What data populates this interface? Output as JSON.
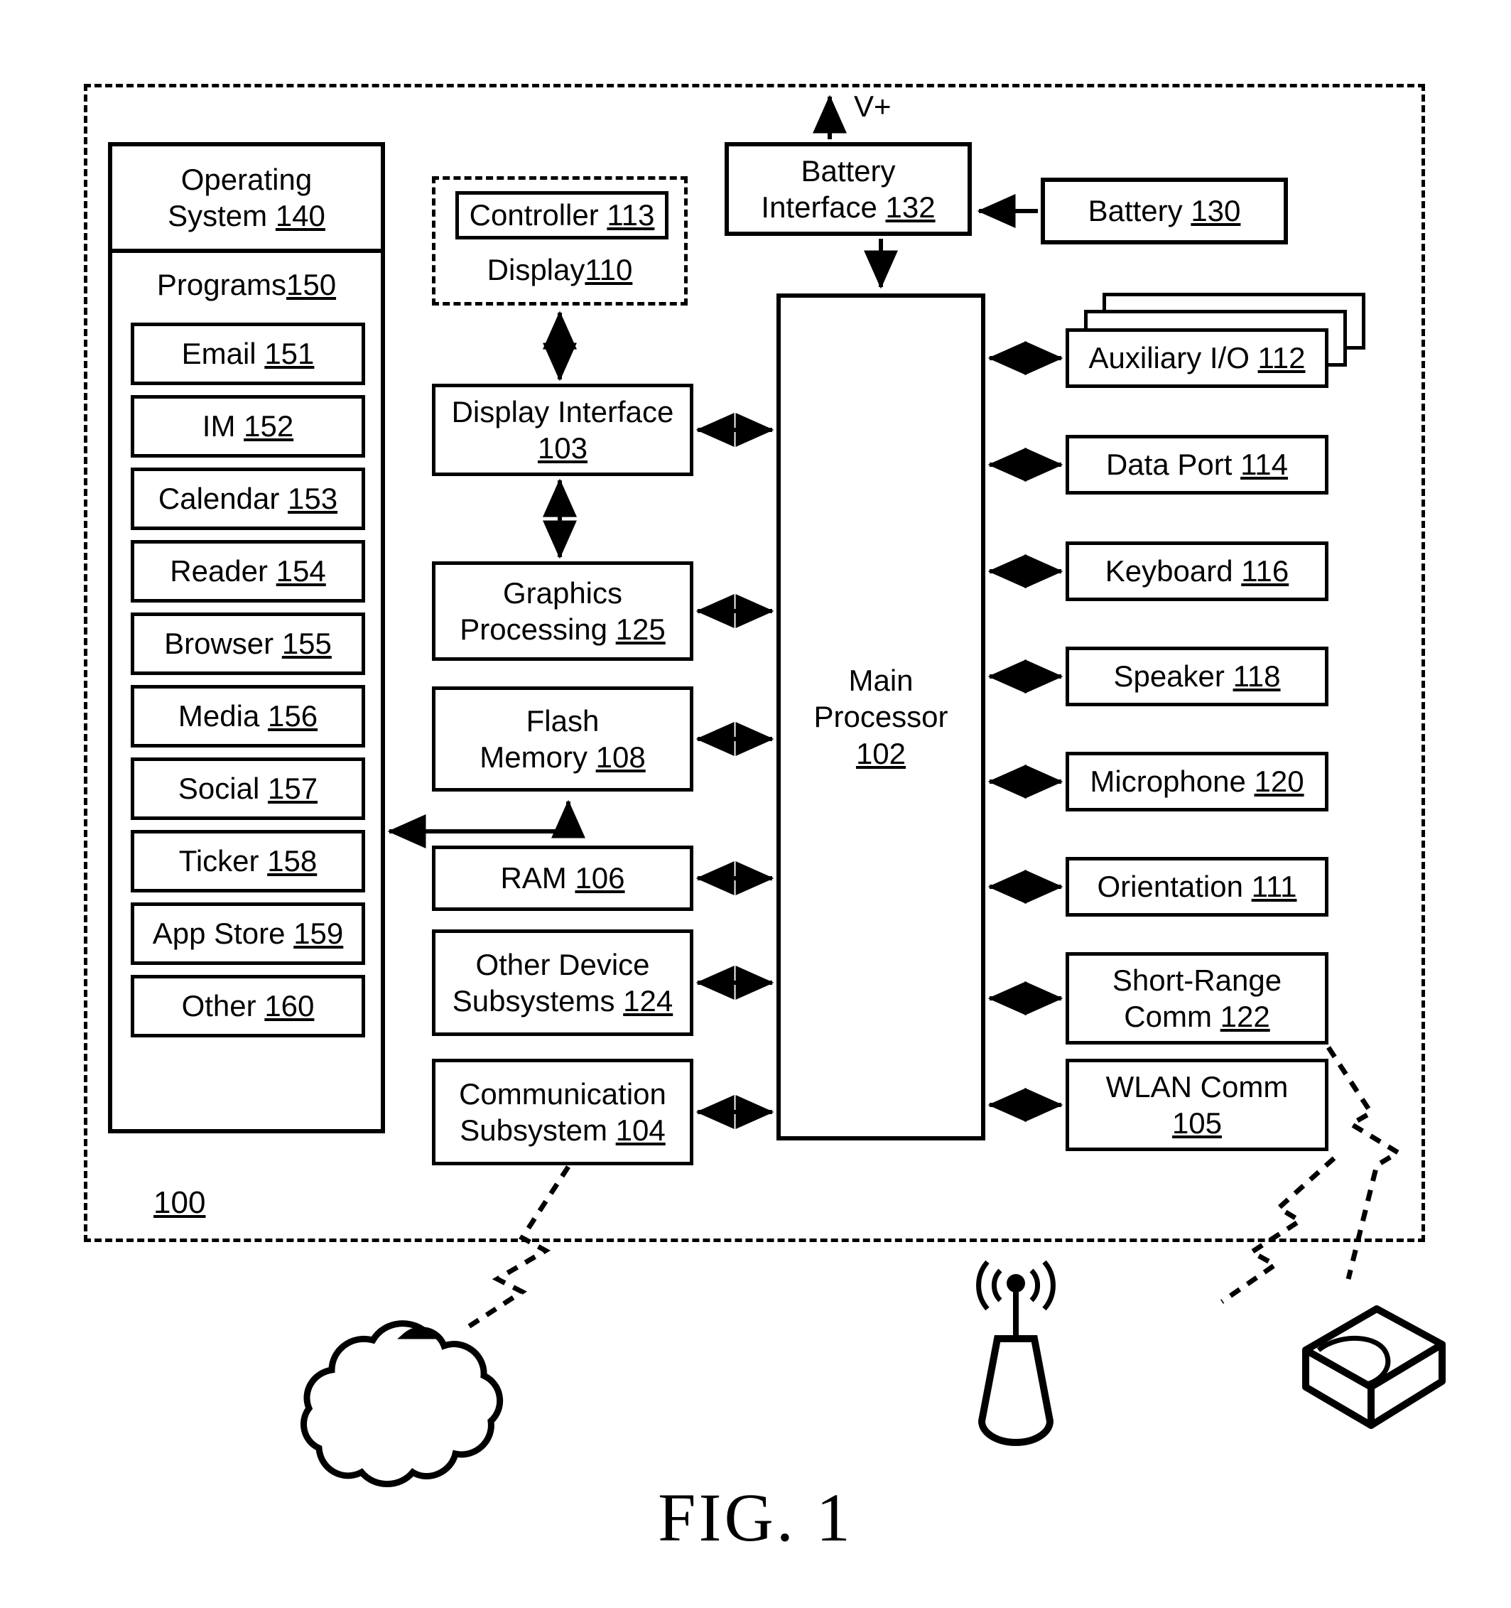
{
  "figure": {
    "caption": "FIG. 1",
    "device_reference": "100",
    "power_label": "V+"
  },
  "software": {
    "operating_system": "Operating\nSystem 140",
    "programs_label": "Programs 150",
    "programs": [
      {
        "label": "Email 151"
      },
      {
        "label": "IM 152"
      },
      {
        "label": "Calendar 153"
      },
      {
        "label": "Reader 154"
      },
      {
        "label": "Browser 155"
      },
      {
        "label": "Media 156"
      },
      {
        "label": "Social 157"
      },
      {
        "label": "Ticker 158"
      },
      {
        "label": "App Store 159"
      },
      {
        "label": "Other 160"
      }
    ]
  },
  "display_group": {
    "controller": "Controller 113",
    "display": "Display 110"
  },
  "middle_column": [
    {
      "label": "Display Interface\n103"
    },
    {
      "label": "Graphics\nProcessing 125"
    },
    {
      "label": "Flash\nMemory 108"
    },
    {
      "label": "RAM 106"
    },
    {
      "label": "Other Device\nSubsystems 124"
    },
    {
      "label": "Communication\nSubsystem 104"
    }
  ],
  "processor": {
    "label": "Main\nProcessor\n102"
  },
  "power": {
    "battery_interface": "Battery\nInterface 132",
    "battery": "Battery 130"
  },
  "peripherals": [
    {
      "label": "Auxiliary I/O 112"
    },
    {
      "label": "Data Port 114"
    },
    {
      "label": "Keyboard 116"
    },
    {
      "label": "Speaker 118"
    },
    {
      "label": "Microphone 120"
    },
    {
      "label": "Orientation 111"
    },
    {
      "label": "Short-Range\nComm 122"
    },
    {
      "label": "WLAN Comm\n105"
    }
  ],
  "external_nodes": [
    {
      "name": "wireless-network-cloud"
    },
    {
      "name": "cell-tower-antenna"
    },
    {
      "name": "external-device"
    }
  ]
}
